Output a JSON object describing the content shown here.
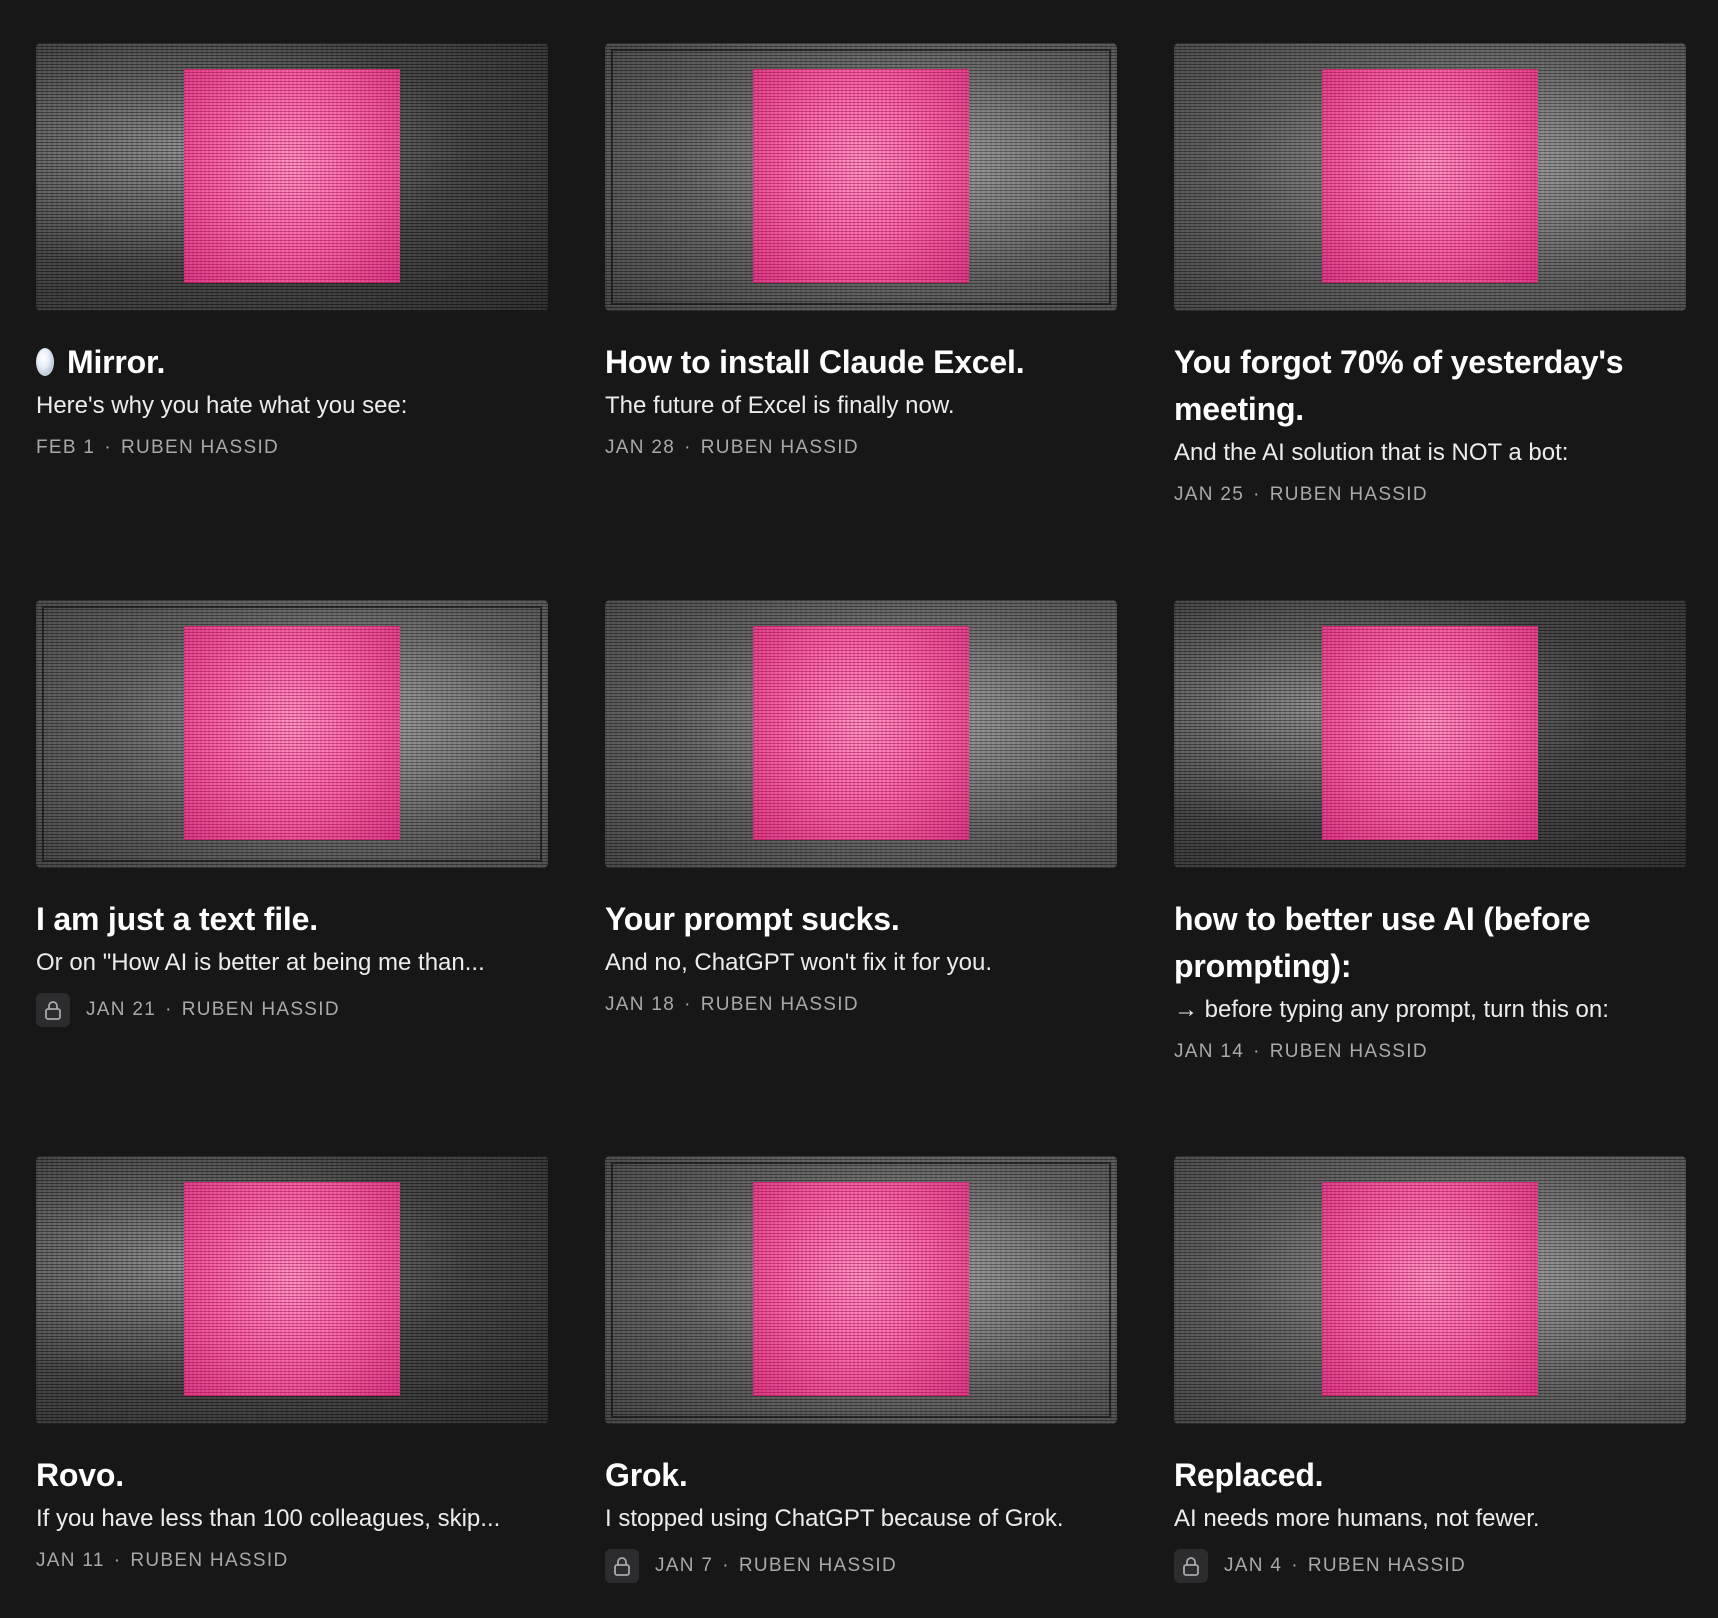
{
  "author": "RUBEN HASSID",
  "meta_separator": "·",
  "colors": {
    "background": "#171718",
    "accent_pink": "#f56ba6",
    "meta_text": "#a9a9ab"
  },
  "posts": [
    {
      "icon": "mirror-gem-icon",
      "title": "Mirror.",
      "subtitle": "Here's why you hate what you see:",
      "date": "FEB 1",
      "locked": false
    },
    {
      "title": "How to install Claude Excel.",
      "subtitle": "The future of Excel is finally now.",
      "date": "JAN 28",
      "locked": false
    },
    {
      "title_line1": "You forgot 70% of yesterday's",
      "title_line2": "meeting.",
      "subtitle": "And the AI solution that is NOT a bot:",
      "date": "JAN 25",
      "locked": false
    },
    {
      "title": "I am just a text file.",
      "subtitle": "Or on \"How AI is better at being me than...",
      "date": "JAN 21",
      "locked": true,
      "icon": "lock-icon"
    },
    {
      "title": "Your prompt sucks.",
      "subtitle": "And no, ChatGPT won't fix it for you.",
      "date": "JAN 18",
      "locked": false
    },
    {
      "title_line1": "how to better use AI (before",
      "title_line2": "prompting):",
      "subtitle": "→ before typing any prompt, turn this on:",
      "date": "JAN 14",
      "locked": false
    },
    {
      "title": "Rovo.",
      "subtitle": "If you have less than 100 colleagues, skip...",
      "date": "JAN 11",
      "locked": false
    },
    {
      "title": "Grok.",
      "subtitle": "I stopped using ChatGPT because of Grok.",
      "date": "JAN 7",
      "locked": true,
      "icon": "lock-icon"
    },
    {
      "title": "Replaced.",
      "subtitle": "AI needs more humans, not fewer.",
      "date": "JAN 4",
      "locked": true,
      "icon": "lock-icon"
    }
  ]
}
